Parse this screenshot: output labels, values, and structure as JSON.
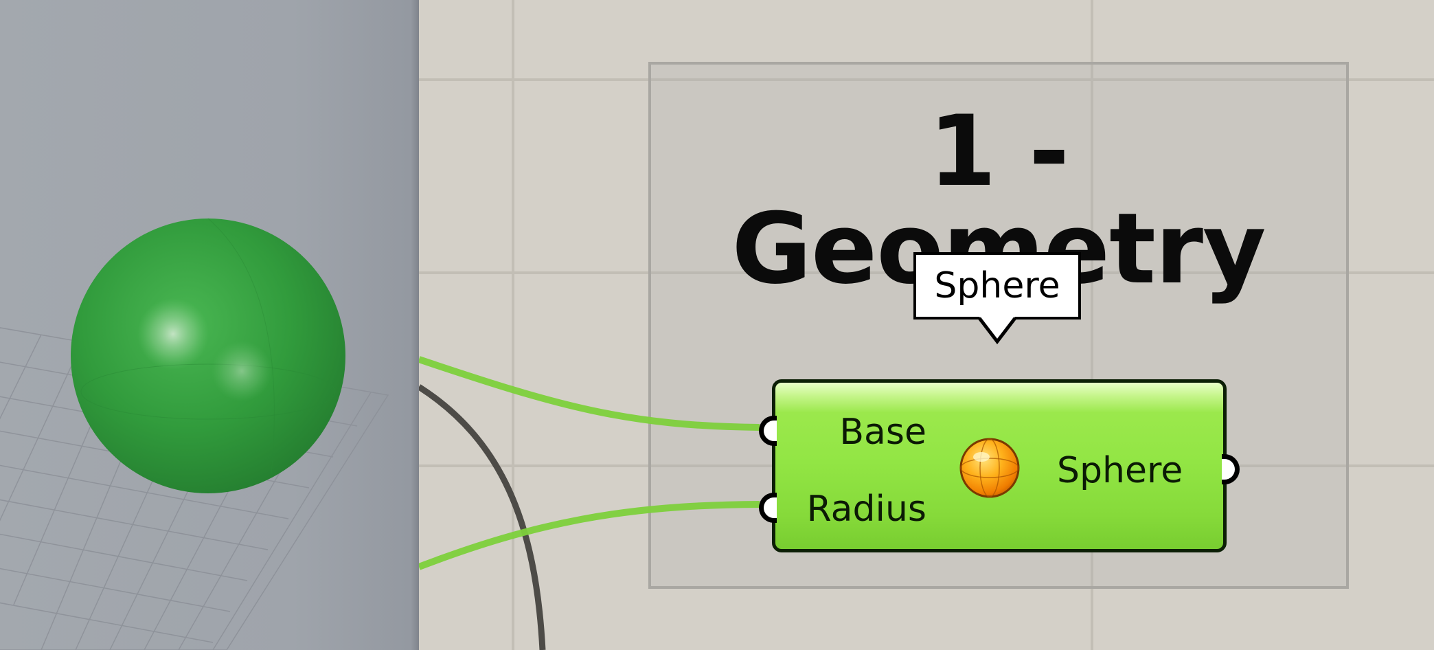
{
  "viewport": {
    "background": "#a0a5ab",
    "sphere_color": "#2f9a3c",
    "grid_color": "#8c9098"
  },
  "canvas": {
    "background": "#d4d0c8",
    "grid_color": "#c1bdb4",
    "group": {
      "title": "1 - Geometry"
    },
    "component": {
      "nickname": "Sphere",
      "inputs": [
        "Base",
        "Radius"
      ],
      "output": "Sphere",
      "icon": "sphere-icon",
      "color": "#92e345"
    },
    "wires": {
      "active_color": "#7dd03c",
      "inactive_color": "#4d4b47"
    }
  }
}
